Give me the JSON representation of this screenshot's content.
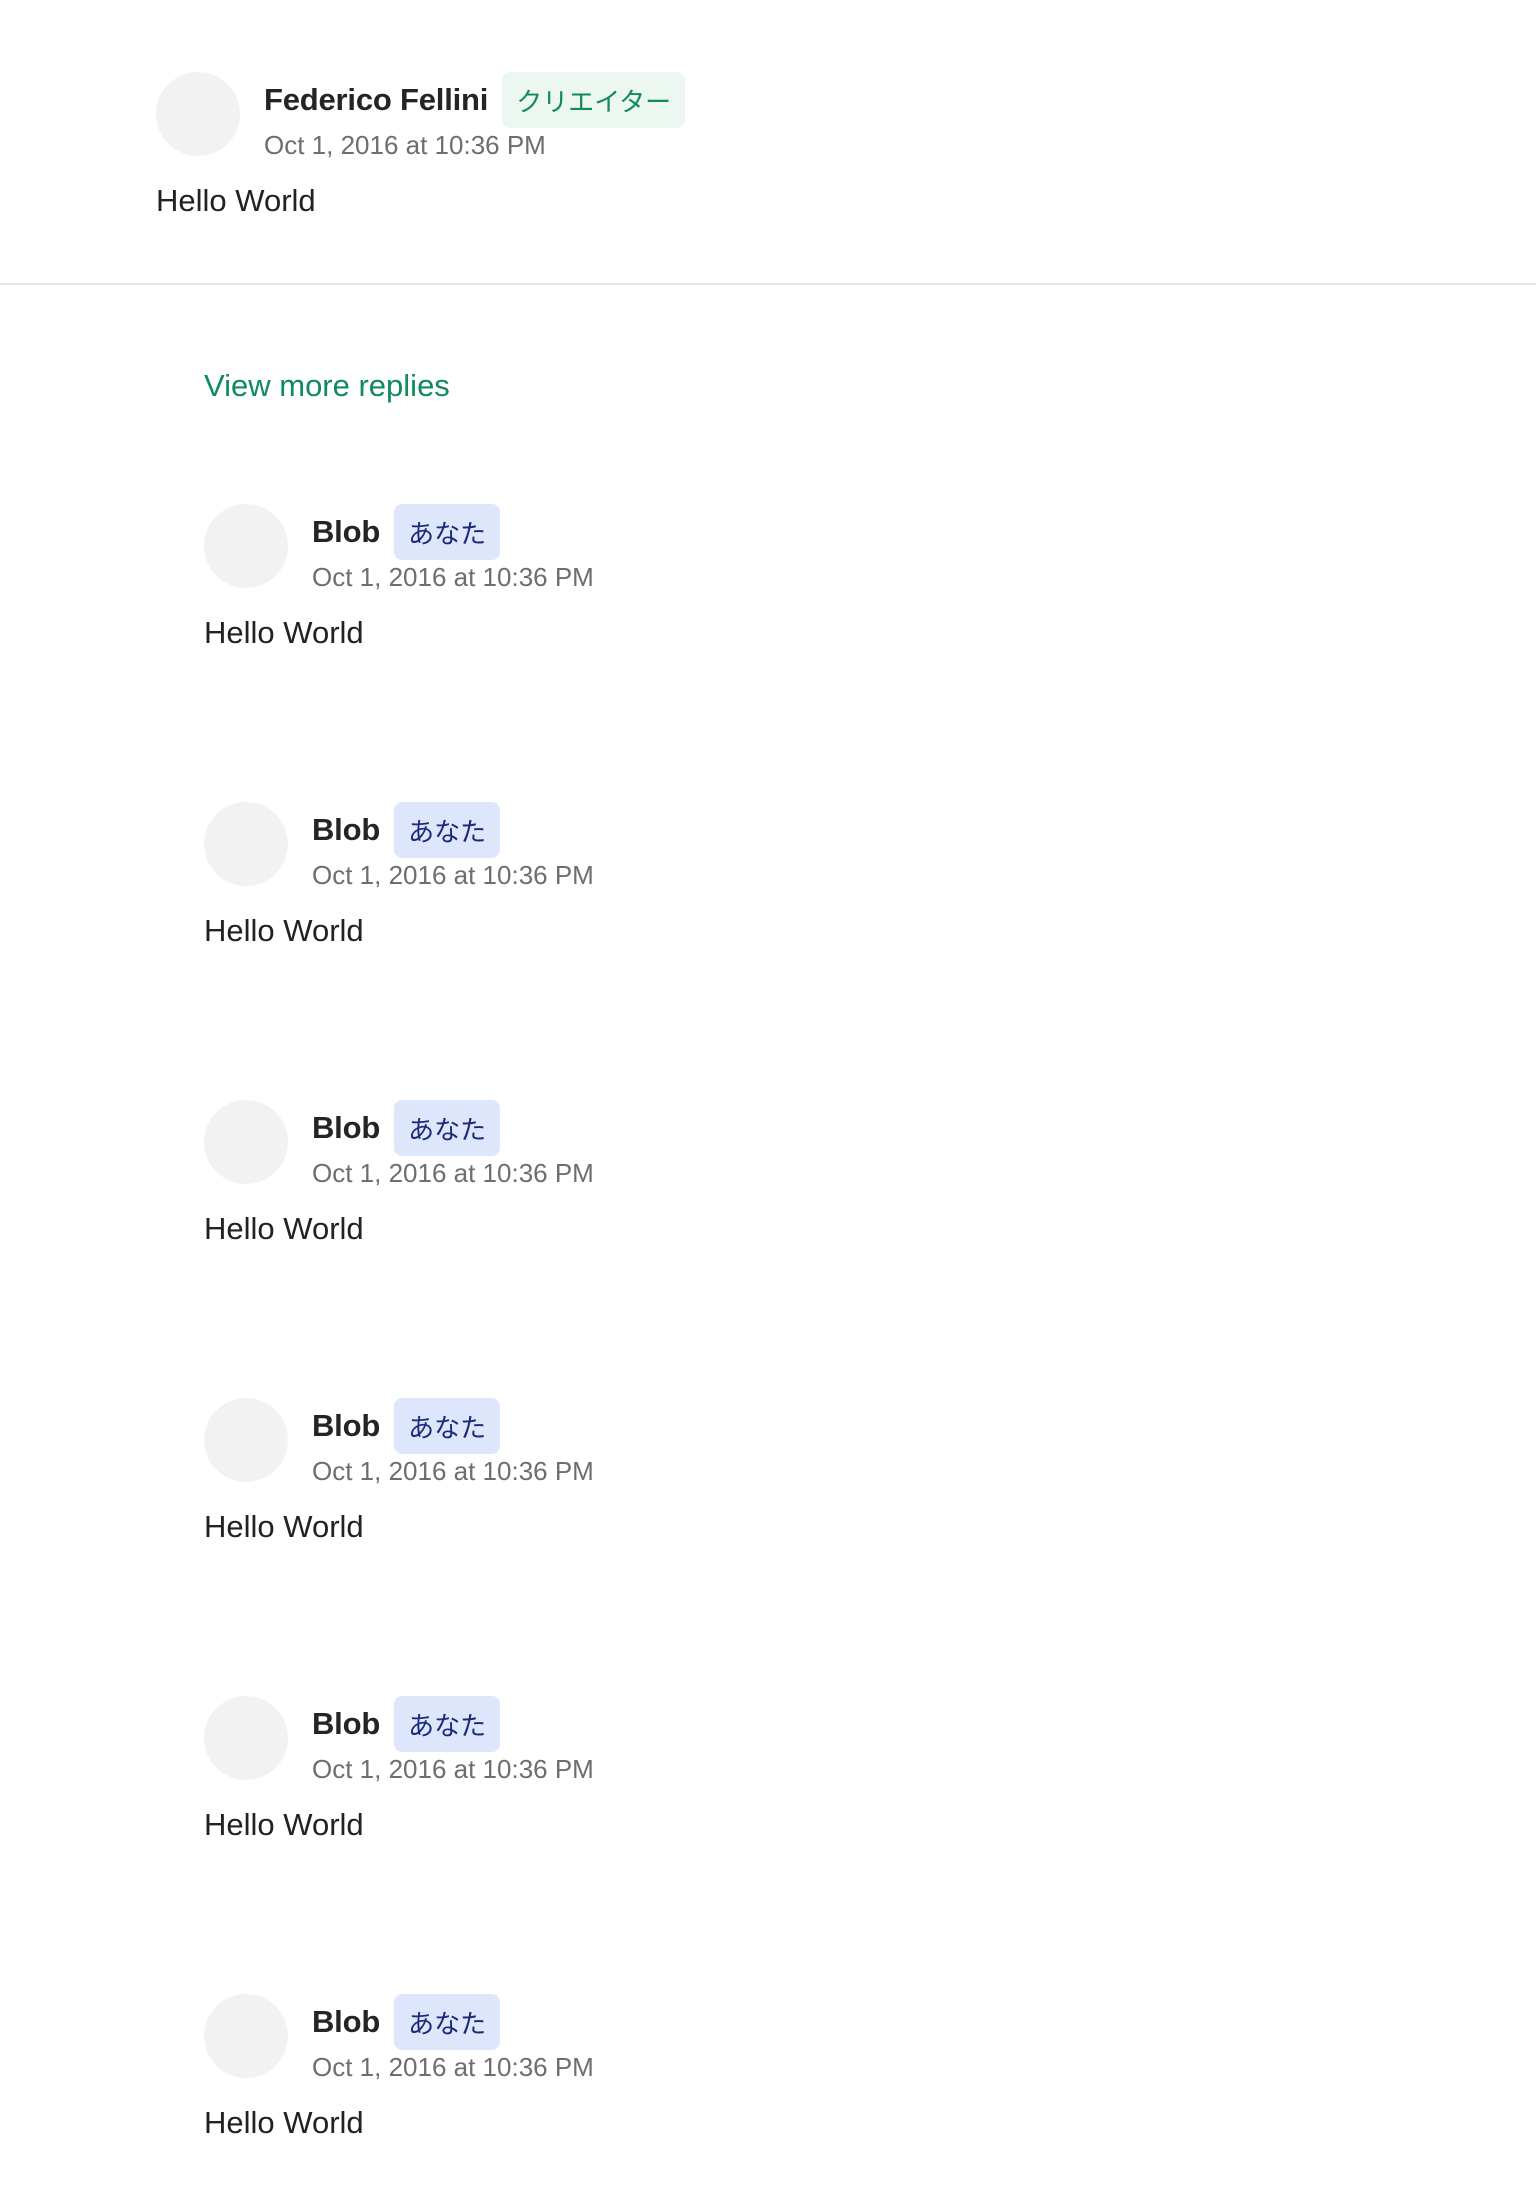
{
  "colors": {
    "accent_green": "#118a5c",
    "creator_badge_bg": "#ecf7f2",
    "you_badge_bg": "#dde6fb",
    "you_badge_text": "#1b2b7a",
    "avatar_placeholder": "#f2f2f2"
  },
  "top_comment": {
    "author": "Federico Fellini",
    "badge": "クリエイター",
    "timestamp": "Oct 1, 2016 at 10:36 PM",
    "body": "Hello World"
  },
  "view_more_label": "View more replies",
  "replies": [
    {
      "author": "Blob",
      "badge": "あなた",
      "timestamp": "Oct 1, 2016 at 10:36 PM",
      "body": "Hello World"
    },
    {
      "author": "Blob",
      "badge": "あなた",
      "timestamp": "Oct 1, 2016 at 10:36 PM",
      "body": "Hello World"
    },
    {
      "author": "Blob",
      "badge": "あなた",
      "timestamp": "Oct 1, 2016 at 10:36 PM",
      "body": "Hello World"
    },
    {
      "author": "Blob",
      "badge": "あなた",
      "timestamp": "Oct 1, 2016 at 10:36 PM",
      "body": "Hello World"
    },
    {
      "author": "Blob",
      "badge": "あなた",
      "timestamp": "Oct 1, 2016 at 10:36 PM",
      "body": "Hello World"
    },
    {
      "author": "Blob",
      "badge": "あなた",
      "timestamp": "Oct 1, 2016 at 10:36 PM",
      "body": "Hello World"
    }
  ]
}
